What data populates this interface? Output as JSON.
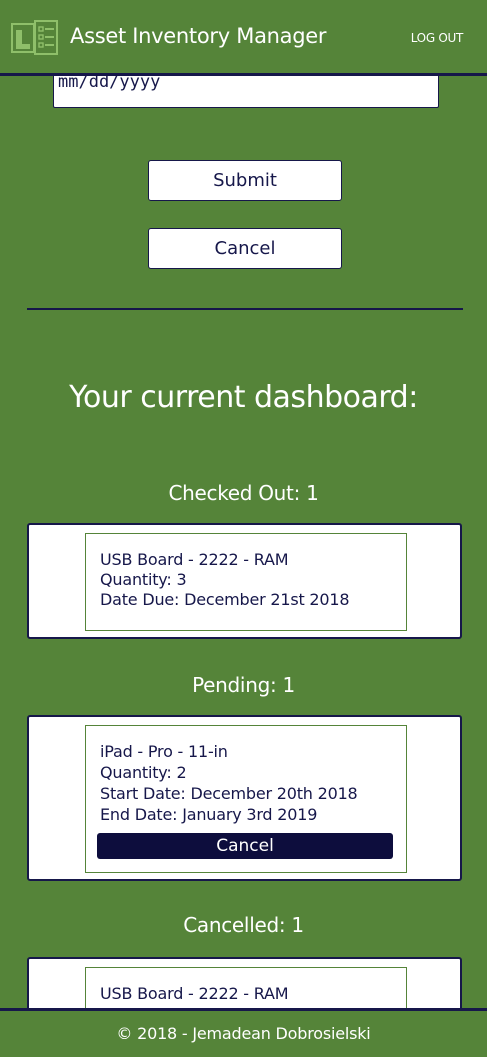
{
  "header": {
    "title": "Asset Inventory Manager",
    "logout_label": "LOG OUT",
    "logo_icon": "inventory-checklist-icon"
  },
  "form": {
    "date_placeholder": "mm/dd/yyyy",
    "submit_label": "Submit",
    "cancel_label": "Cancel"
  },
  "dashboard": {
    "heading": "Your current dashboard:",
    "checked_out": {
      "heading": "Checked Out: 1",
      "items": [
        {
          "name": "USB Board - 2222 - RAM",
          "quantity": "Quantity: 3",
          "date_due": "Date Due: December 21st 2018"
        }
      ]
    },
    "pending": {
      "heading": "Pending: 1",
      "items": [
        {
          "name": "iPad - Pro - 11-in",
          "quantity": "Quantity: 2",
          "start_date": "Start Date: December 20th 2018",
          "end_date": "End Date: January 3rd 2019",
          "cancel_label": "Cancel"
        }
      ]
    },
    "cancelled": {
      "heading": "Cancelled: 1",
      "items": [
        {
          "name": "USB Board - 2222 - RAM"
        }
      ]
    }
  },
  "footer": {
    "copyright": "© 2018 - Jemadean Dobrosielski"
  },
  "colors": {
    "background": "#558439",
    "navy": "#16174a",
    "button_dark": "#0d0d3d",
    "white": "#ffffff"
  }
}
